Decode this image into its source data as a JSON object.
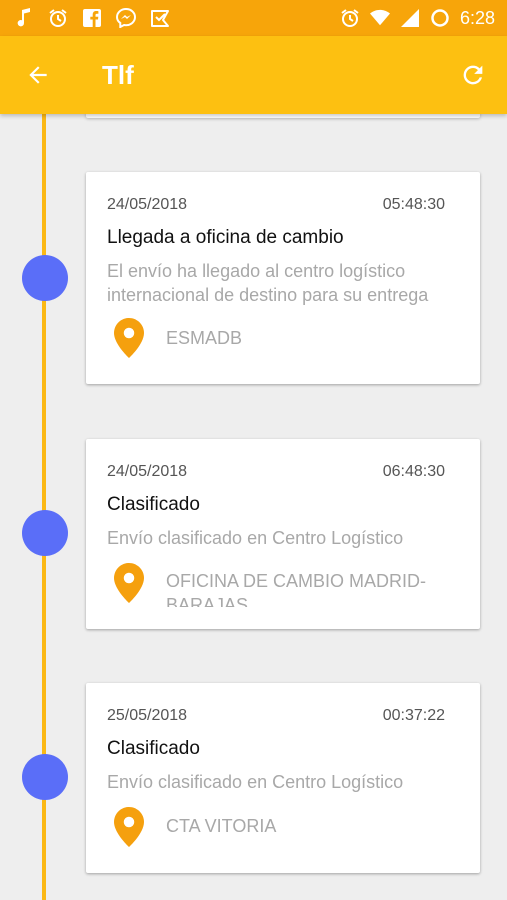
{
  "status_bar": {
    "time": "6:28",
    "left_icons": [
      "music-note-icon",
      "alarm-icon",
      "facebook-icon",
      "messenger-icon",
      "inbox-icon"
    ],
    "right_icons": [
      "alarm-icon",
      "wifi-icon",
      "signal-icon",
      "battery-icon"
    ]
  },
  "app_bar": {
    "title": "Tlf",
    "back_icon": "arrow-back-icon",
    "refresh_icon": "refresh-icon",
    "background_color": "#fdc011"
  },
  "timeline": {
    "line_color": "#fbb815",
    "dot_color": "#5a6ef8",
    "events": [
      {
        "date": "24/05/2018",
        "time": "05:48:30",
        "title": "Llegada a oficina de cambio",
        "description": "El envío ha llegado al centro logístico internacional de destino para su entrega",
        "location": "ESMADB"
      },
      {
        "date": "24/05/2018",
        "time": "06:48:30",
        "title": "Clasificado",
        "description": "Envío clasificado en Centro Logístico",
        "location": "OFICINA DE CAMBIO MADRID-BARAJAS"
      },
      {
        "date": "25/05/2018",
        "time": "00:37:22",
        "title": "Clasificado",
        "description": "Envío clasificado en Centro Logístico",
        "location": "CTA VITORIA"
      }
    ]
  }
}
